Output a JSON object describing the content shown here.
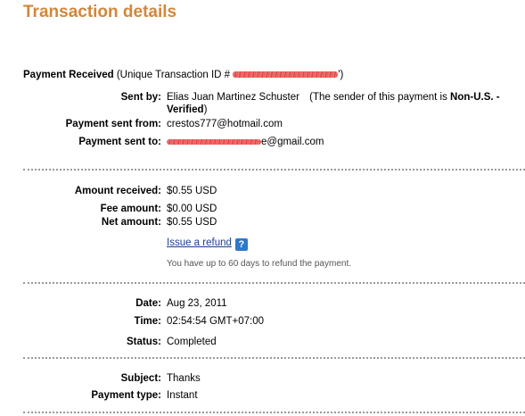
{
  "page_title": "Transaction details",
  "payment_received": {
    "label": "Payment Received",
    "id_prefix": "(Unique Transaction ID #",
    "id_suffix": "')"
  },
  "sender": {
    "sent_by_label": "Sent by:",
    "sent_by_name": "Elias Juan Martinez Schuster",
    "sent_by_note_prefix": "(The sender of this payment is",
    "sent_by_status": "Non-U.S. -",
    "sent_by_status_2": "Verified",
    "sent_by_note_close": ")",
    "sent_from_label": "Payment sent from:",
    "sent_from_value": "crestos777@hotmail.com",
    "sent_to_label": "Payment sent to:",
    "sent_to_suffix": "e@gmail.com"
  },
  "amounts": {
    "received_label": "Amount received:",
    "received_value": "$0.55 USD",
    "fee_label": "Fee amount:",
    "fee_value": "$0.00 USD",
    "net_label": "Net amount:",
    "net_value": "$0.55 USD",
    "refund_link": "Issue a refund",
    "help_glyph": "?",
    "refund_note": "You have up to 60 days to refund the payment."
  },
  "details": {
    "date_label": "Date:",
    "date_value": "Aug 23, 2011",
    "time_label": "Time:",
    "time_value": "02:54:54 GMT+07:00",
    "status_label": "Status:",
    "status_value": "Completed"
  },
  "extra": {
    "subject_label": "Subject:",
    "subject_value": "Thanks",
    "type_label": "Payment type:",
    "type_value": "Instant"
  },
  "colors": {
    "title": "#d2873a",
    "link": "#1a3f8a",
    "redaction": "#e84a4a",
    "separator": "#9a9a9a"
  }
}
